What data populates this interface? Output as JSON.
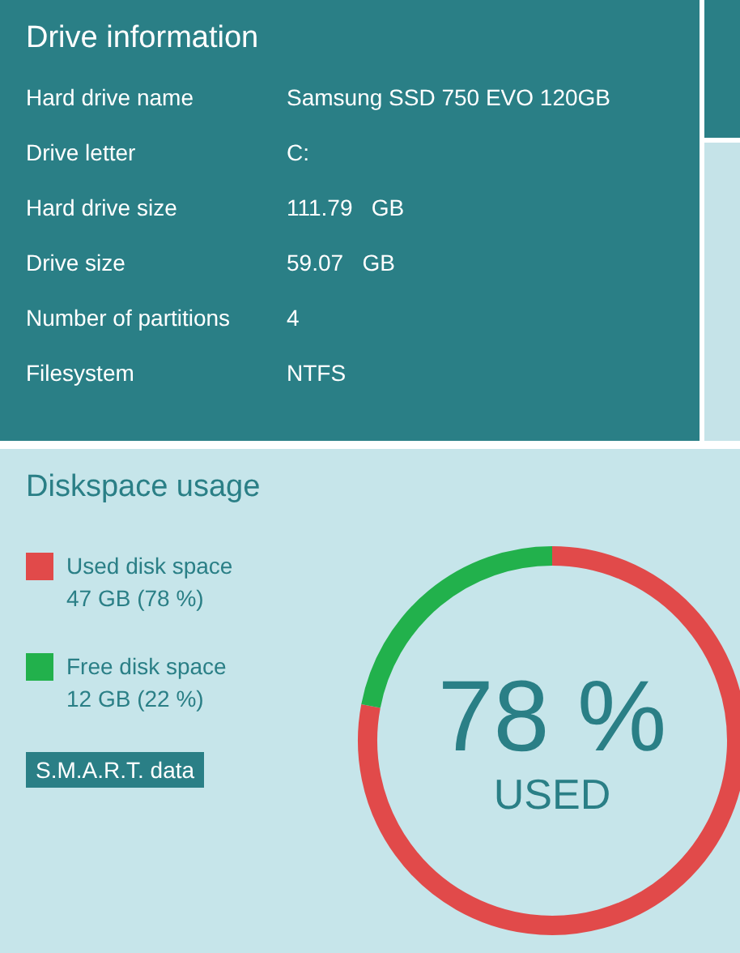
{
  "drive_info": {
    "title": "Drive information",
    "rows": [
      {
        "label": "Hard drive name",
        "value": "Samsung SSD 750 EVO 120GB"
      },
      {
        "label": "Drive letter",
        "value": "C:"
      },
      {
        "label": "Hard drive size",
        "value": "111.79   GB"
      },
      {
        "label": "Drive size",
        "value": "59.07   GB"
      },
      {
        "label": "Number of partitions",
        "value": "4"
      },
      {
        "label": "Filesystem",
        "value": "NTFS"
      }
    ]
  },
  "diskspace": {
    "title": "Diskspace usage",
    "legend": [
      {
        "label": "Used disk space",
        "detail": "47 GB (78 %)",
        "color": "#e14a4a"
      },
      {
        "label": "Free disk space",
        "detail": "12 GB (22 %)",
        "color": "#22b14c"
      }
    ],
    "smart_button": "S.M.A.R.T. data",
    "percent": "78 %",
    "caption": "USED"
  }
}
